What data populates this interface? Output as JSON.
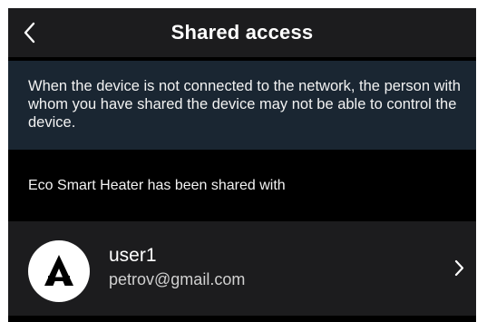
{
  "header": {
    "title": "Shared access",
    "back_icon": "chevron-left-icon"
  },
  "notice": {
    "text": "When the device is not connected to the network, the person with whom you have shared the device may not be able to control the device."
  },
  "shared_section": {
    "heading": "Eco Smart Heater has been shared with"
  },
  "users": [
    {
      "name": "user1",
      "email": "petrov@gmail.com",
      "avatar_icon": "a-logo-icon",
      "chevron_icon": "chevron-right-icon"
    }
  ],
  "colors": {
    "background": "#000000",
    "nav_bar": "#1c1c1e",
    "notice_background": "#1a2632",
    "row_background": "#1c1c1e",
    "text_primary": "#ffffff",
    "text_secondary": "#d0d0d0"
  }
}
